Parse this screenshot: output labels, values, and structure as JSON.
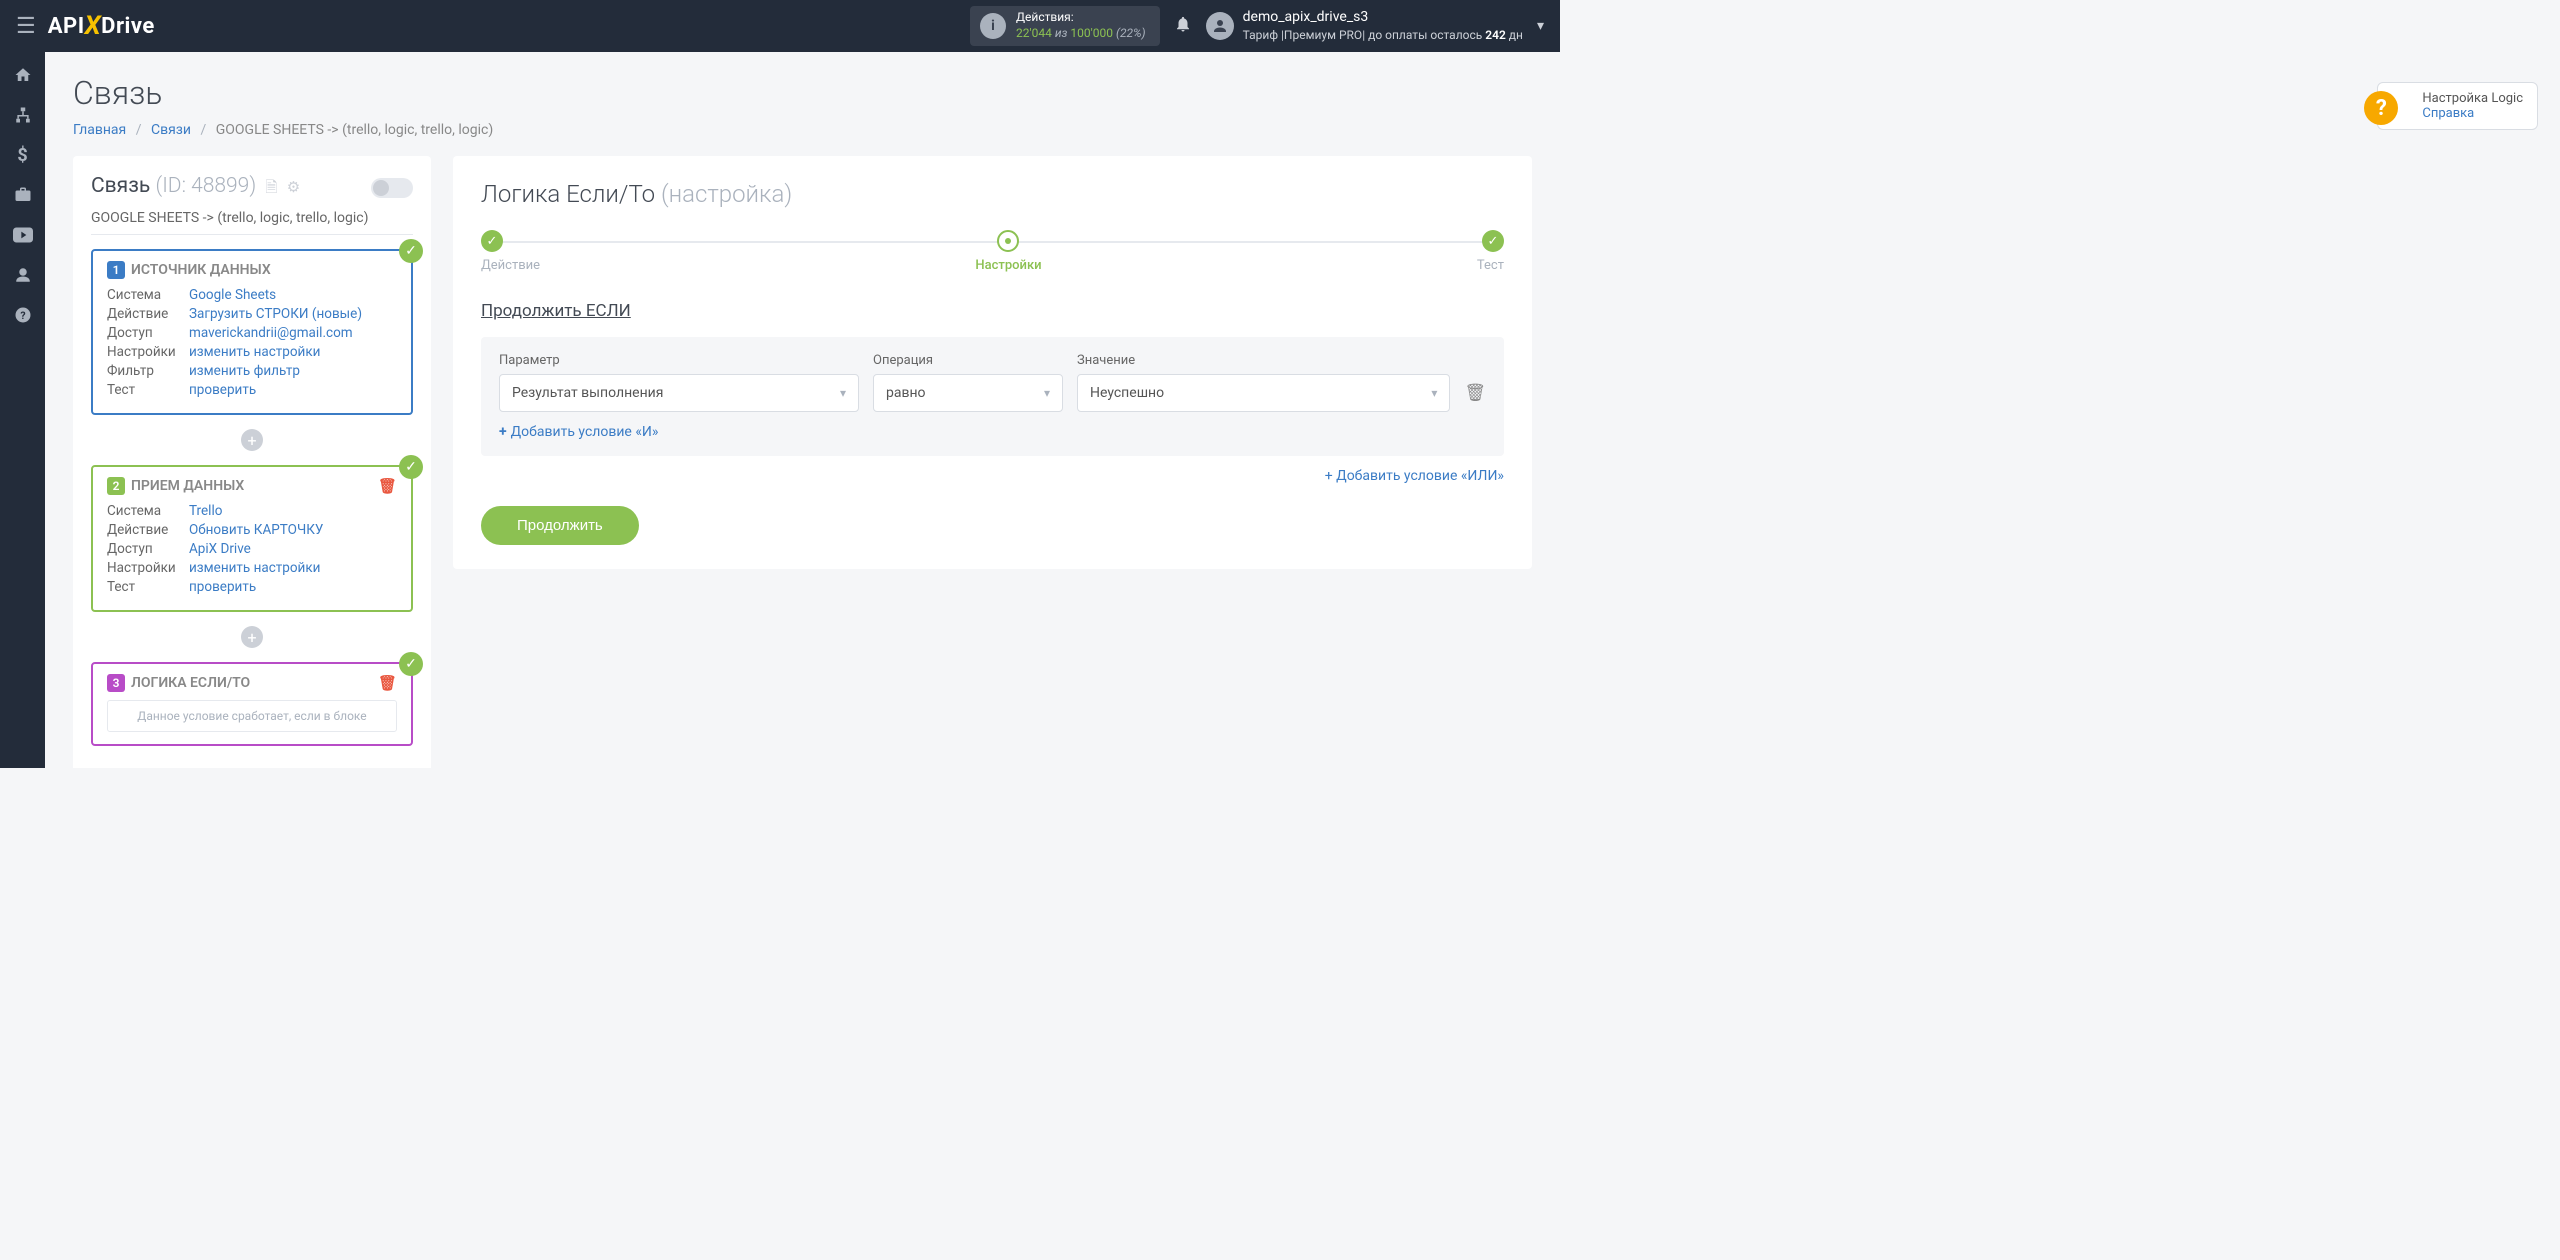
{
  "topbar": {
    "logo_text_a": "API",
    "logo_text_b": "Drive",
    "actions_label": "Действия:",
    "actions_used": "22'044",
    "actions_of": "из",
    "actions_total": "100'000",
    "actions_pct": "(22%)",
    "user_name": "demo_apix_drive_s3",
    "tariff_prefix": "Тариф |Премиум PRO| до оплаты осталось ",
    "tariff_days": "242",
    "tariff_suffix": " дн"
  },
  "helptip": {
    "t1": "Настройка Logic",
    "t2": "Справка"
  },
  "sidenav": [
    "home",
    "sitemap",
    "dollar",
    "briefcase",
    "youtube",
    "user",
    "question"
  ],
  "page_title": "Связь",
  "breadcrumb": {
    "home": "Главная",
    "links": "Связи",
    "current": "GOOGLE SHEETS -> (trello, logic, trello, logic)"
  },
  "left": {
    "conn_label": "Связь",
    "conn_id": "(ID: 48899)",
    "conn_name": "GOOGLE SHEETS -> (trello, logic, trello, logic)",
    "steps": [
      {
        "num": "1",
        "title": "ИСТОЧНИК ДАННЫХ",
        "color": "blue",
        "check": true,
        "trash": false,
        "rows": [
          {
            "lbl": "Система",
            "val": "Google Sheets"
          },
          {
            "lbl": "Действие",
            "val": "Загрузить СТРОКИ (новые)"
          },
          {
            "lbl": "Доступ",
            "val": "maverickandrii@gmail.com"
          },
          {
            "lbl": "Настройки",
            "val": "изменить настройки"
          },
          {
            "lbl": "Фильтр",
            "val": "изменить фильтр"
          },
          {
            "lbl": "Тест",
            "val": "проверить"
          }
        ]
      },
      {
        "num": "2",
        "title": "ПРИЕМ ДАННЫХ",
        "color": "green",
        "check": true,
        "trash": true,
        "rows": [
          {
            "lbl": "Система",
            "val": "Trello"
          },
          {
            "lbl": "Действие",
            "val": "Обновить КАРТОЧКУ"
          },
          {
            "lbl": "Доступ",
            "val": "ApiX Drive"
          },
          {
            "lbl": "Настройки",
            "val": "изменить настройки"
          },
          {
            "lbl": "Тест",
            "val": "проверить"
          }
        ]
      },
      {
        "num": "3",
        "title": "ЛОГИКА ЕСЛИ/ТО",
        "color": "purple",
        "check": true,
        "trash": true,
        "rows": [],
        "desc": "Данное условие сработает, если в блоке"
      }
    ]
  },
  "right": {
    "title_main": "Логика Если/То",
    "title_sub": "(настройка)",
    "stepper": [
      {
        "label": "Действие",
        "state": "done"
      },
      {
        "label": "Настройки",
        "state": "active"
      },
      {
        "label": "Тест",
        "state": "done"
      }
    ],
    "section": "Продолжить ЕСЛИ",
    "cond_labels": {
      "param": "Параметр",
      "op": "Операция",
      "val": "Значение"
    },
    "cond": {
      "param": "Результат выполнения",
      "op": "равно",
      "val": "Неуспешно"
    },
    "add_and": "Добавить условие «И»",
    "add_or": "Добавить условие «ИЛИ»",
    "continue": "Продолжить"
  }
}
